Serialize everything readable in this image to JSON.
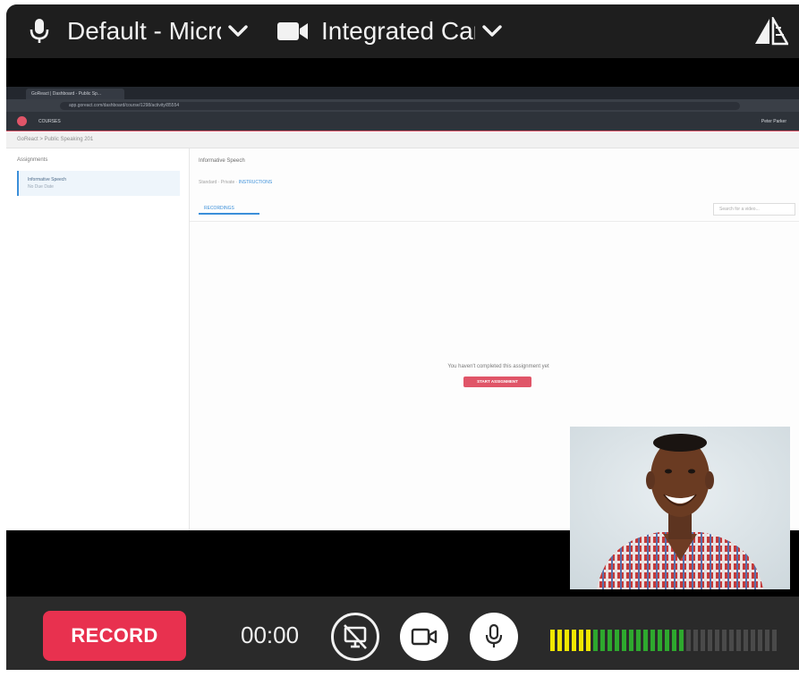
{
  "topbar": {
    "microphone": {
      "label": "Default - Microphone",
      "icon": "microphone-icon"
    },
    "camera": {
      "label": "Integrated Camera",
      "icon": "video-camera-icon"
    },
    "layout_icon": "layout-perspective-icon"
  },
  "screen_share": {
    "browser_tab": "GoReact | Dashboard - Public Sp...",
    "address": "app.goreact.com/dashboard/course/1298/activity/85554",
    "app_menu": "COURSES",
    "user_menu": "Peter Parker",
    "breadcrumb": "GoReact > Public Speaking 201",
    "sidebar_header": "Assignments",
    "assignment_title": "Informative Speech",
    "assignment_sub": "No Due Date",
    "content_title": "Informative Speech",
    "meta": "Standard · Private ·",
    "instructions": "INSTRUCTIONS",
    "recordings_tab": "RECORDINGS",
    "search_placeholder": "Search for a video...",
    "empty_message": "You haven't completed this assignment yet",
    "start_button": "START ASSIGNMENT"
  },
  "controls": {
    "record_label": "RECORD",
    "timer": "00:00",
    "screen_icon": "screen-share-off-icon",
    "camera_icon": "camera-toggle-icon",
    "mic_icon": "microphone-toggle-icon",
    "audio_level": {
      "segments": 32,
      "lit_yellow": 6,
      "lit_green": 13
    },
    "colors": {
      "record": "#e8314f",
      "meter_yellow": "#f0e600",
      "meter_green": "#2ea82e",
      "meter_off": "#4a4a4a"
    }
  }
}
